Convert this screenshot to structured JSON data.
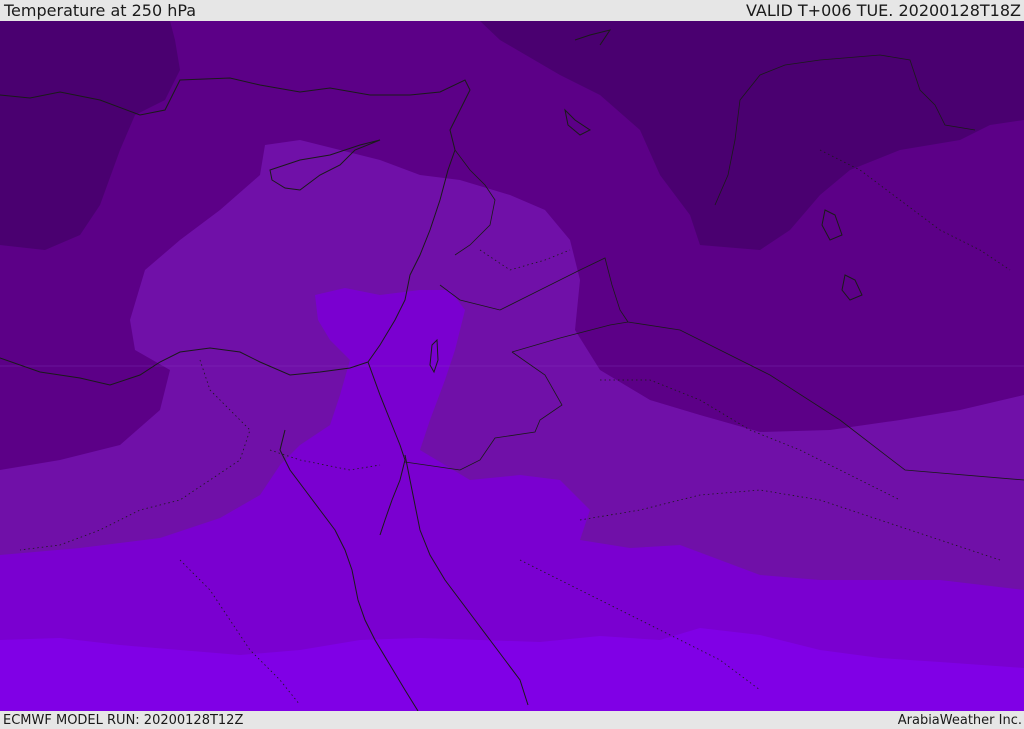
{
  "header": {
    "title": "Temperature at 250 hPa",
    "valid": "VALID T+006 TUE. 20200128T18Z"
  },
  "footer": {
    "model_run": "ECMWF MODEL RUN: 20200128T12Z",
    "credit": "ArabiaWeather Inc."
  },
  "map": {
    "field": "temperature",
    "level": "250 hPa",
    "palette": [
      "#4a0070",
      "#5c0087",
      "#7010a8",
      "#7a00d0",
      "#8000e6",
      "#7a00ff"
    ],
    "border_color": "#1a1a1a"
  }
}
